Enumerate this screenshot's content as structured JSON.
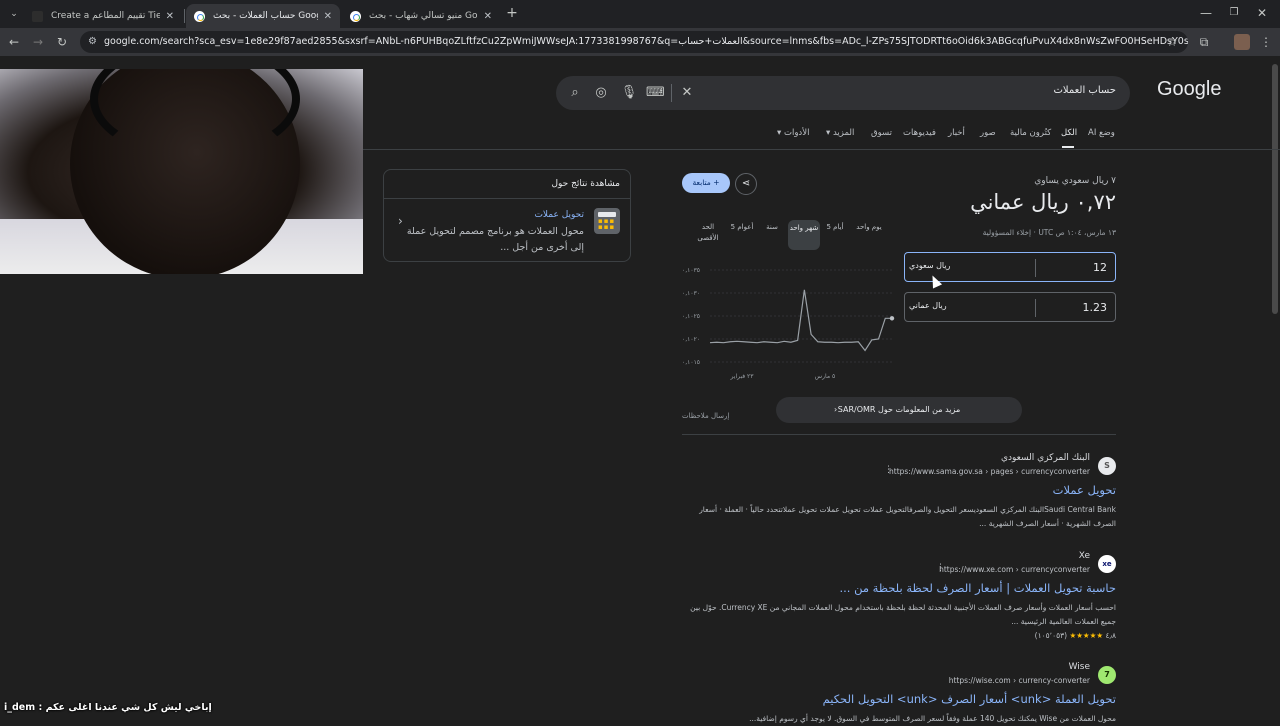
{
  "browser": {
    "tabs": [
      {
        "title": "Create a تقييم المطاعم Tier List",
        "active": false
      },
      {
        "title": "حساب العملات - بحث Google",
        "active": true
      },
      {
        "title": "منيو تسالي شهاب - بحث Google",
        "active": false
      }
    ],
    "url": "google.com/search?sca_esv=1e8e29f87aed2855&sxsrf=ANbL-n6PUHBqoZLftfzCu2ZpWmiJWWseJA:1773381998767&q=العملات+حساب&source=lnms&fbs=ADc_l-ZPs75SJTODRTt6oOid6k3ABGcqfuPvuX4dx8nWsZwFO0HSeHDsY0sTjY7ZfzpNecDlvckVb9eT..."
  },
  "google": {
    "logo": "Google",
    "query": "حساب العملات",
    "nav_tabs": [
      "وضع AI",
      "الكل",
      "كتُرون مالية",
      "صور",
      "أخبار",
      "فيديوهات",
      "تسوق",
      "المزيد",
      "الأدوات"
    ]
  },
  "converter": {
    "equals_text": "٧ ريال سعودي يساوي",
    "result": "٠,٧٢ ريال عماني",
    "timestamp": "١٣ مارس، ١:٠٤ ص UTC · إخلاء المسؤولية",
    "from_value": "12",
    "from_unit": "ريال سعودي",
    "to_value": "1.23",
    "to_unit": "ريال عماني",
    "follow_label": "+ متابعة",
    "ranges": [
      "يوم واحد",
      "5 أيام",
      "شهر واحد",
      "سنة",
      "5 أعوام",
      "الحد الأقصى"
    ],
    "active_range": "شهر واحد",
    "more_info": "مزيد من المعلومات حول SAR/OMR",
    "feedback": "إرسال ملاحظات"
  },
  "chart_data": {
    "type": "line",
    "y_ticks": [
      "٠,١٠٣٥",
      "٠,١٠٣٠",
      "٠,١٠٢٥",
      "٠,١٠٢٠",
      "٠,١٠١٥"
    ],
    "x_ticks": [
      "٢٣ فبراير",
      "٥ مارس"
    ],
    "ylim": [
      0.1015,
      0.1035
    ],
    "values": [
      0.10192,
      0.10193,
      0.10192,
      0.10194,
      0.10195,
      0.10194,
      0.10193,
      0.10192,
      0.10194,
      0.10193,
      0.10192,
      0.10195,
      0.10193,
      0.10197,
      0.10307,
      0.1021,
      0.10194,
      0.10193,
      0.10193,
      0.10192,
      0.10193,
      0.10193,
      0.10194,
      0.10175,
      0.10198,
      0.102,
      0.10245,
      0.10245
    ]
  },
  "sidecard": {
    "header": "مشاهدة نتائج حول",
    "title": "تحويل عملات",
    "description": "محول العملات هو برنامج مصمم لتحويل عملة إلى أخرى من أجل ..."
  },
  "results": [
    {
      "site": "البنك المركزي السعودي",
      "url": "https://www.sama.gov.sa › pages › currencyconverter",
      "favicon": "S",
      "title": "تحويل عملات",
      "snippet": "Saudi Central Bankالبنك المركزي السعوديسعر التحويل والصرفالتحويل عملات تحويل عملات تحويل عملاتتحدد حالياً · العملة · أسعار الصرف الشهرية · أسعار الصرف الشهرية ..."
    },
    {
      "site": "Xe",
      "url": "https://www.xe.com › currencyconverter",
      "favicon": "xe",
      "title": "حاسبة تحويل العملات | أسعار الصرف لحظة بلحظة من ...",
      "snippet": "احسب أسعار العملات وأسعار صرف العملات الأجنبية المحدثة لحظة بلحظة باستخدام محول العملات المجاني من Currency XE. حوّل بين جميع العملات العالمية الرئيسية ...",
      "rating": "٤٫٨",
      "stars": "★★★★★",
      "count": "(١٠٥٬٠٥٣)"
    },
    {
      "site": "Wise",
      "url": "https://wise.com › currency-converter",
      "favicon": "7",
      "title": "تحويل العملة <unk> أسعار الصرف <unk> التحويل الحكيم",
      "snippet": "محول العملات من Wise يمكنك تحويل 140 عملة وفقاً لسعر الصرف المتوسط في السوق. لا يوجد أي رسوم إضافية..."
    }
  ],
  "overlay": {
    "text": "i_dem : إباخي ليش كل شي عندنا اغلى عكم"
  }
}
